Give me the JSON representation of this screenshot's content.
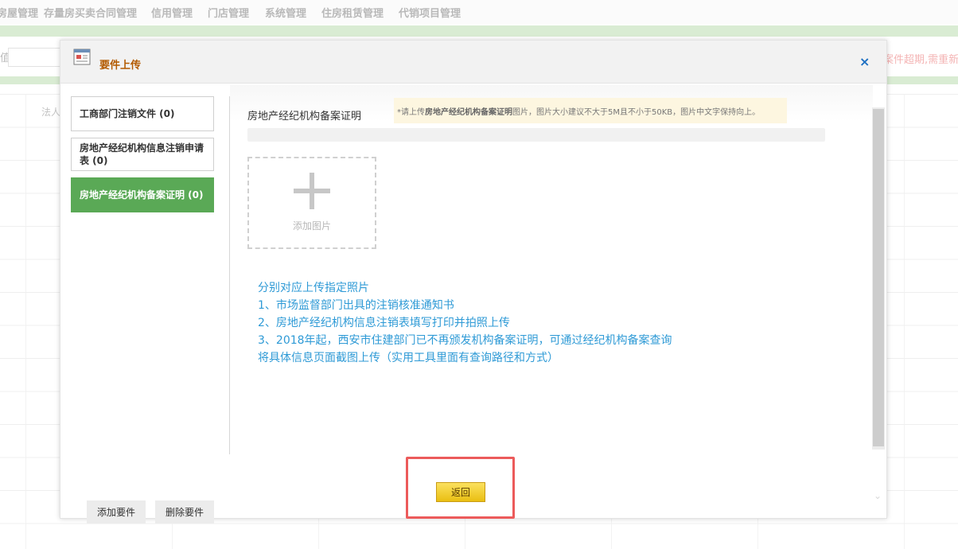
{
  "background": {
    "nav_items": [
      "房屋管理",
      "存量房买卖合同管理",
      "信用管理",
      "门店管理",
      "系统管理",
      "住房租赁管理",
      "代销项目管理"
    ],
    "search_label": "值",
    "warning_text": "案件超期,需重新申",
    "table_header": "法人"
  },
  "modal": {
    "title": "要件上传",
    "close_label": "×",
    "icon": "document-form-icon",
    "sidebar": {
      "items": [
        {
          "label": "工商部门注销文件 (0)",
          "active": false
        },
        {
          "label": "房地产经纪机构信息注销申请表 (0)",
          "active": false
        },
        {
          "label": "房地产经纪机构备案证明 (0)",
          "active": true
        }
      ],
      "add_label": "添加要件",
      "delete_label": "删除要件"
    },
    "content": {
      "field_label": "房地产经纪机构备案证明",
      "hint_prefix": "*请上传",
      "hint_bold": "房地产经纪机构备案证明",
      "hint_suffix": "图片，图片大小建议不大于5M且不小于50KB，图片中文字保持向上。",
      "upload_progress_percent": 0,
      "add_photo_label": "添加图片",
      "instructions": [
        "分别对应上传指定照片",
        "1、市场监督部门出具的注销核准通知书",
        "2、房地产经纪机构信息注销表填写打印并拍照上传",
        "3、2018年起，西安市住建部门已不再颁发机构备案证明，可通过经纪机构备案查询",
        "将具体信息页面截图上传（实用工具里面有查询路径和方式）"
      ]
    },
    "return_label": "返回",
    "colors": {
      "active_tab": "#5aa956",
      "instruction_text": "#2e9ad6",
      "title_text": "#b35a00",
      "highlight": "#ec5b5b"
    }
  }
}
